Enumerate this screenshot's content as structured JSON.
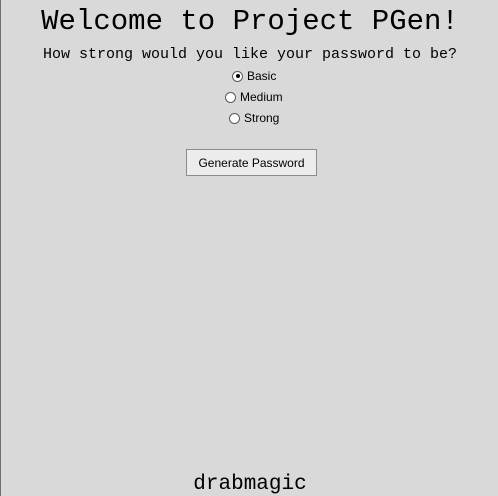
{
  "app": {
    "title": "Welcome to Project PGen!",
    "prompt": "How strong would you like your password to be?",
    "footer": "drabmagic"
  },
  "strength_options": [
    {
      "label": "Basic",
      "selected": true
    },
    {
      "label": "Medium",
      "selected": false
    },
    {
      "label": "Strong",
      "selected": false
    }
  ],
  "generate_button": {
    "label": "Generate Password"
  }
}
